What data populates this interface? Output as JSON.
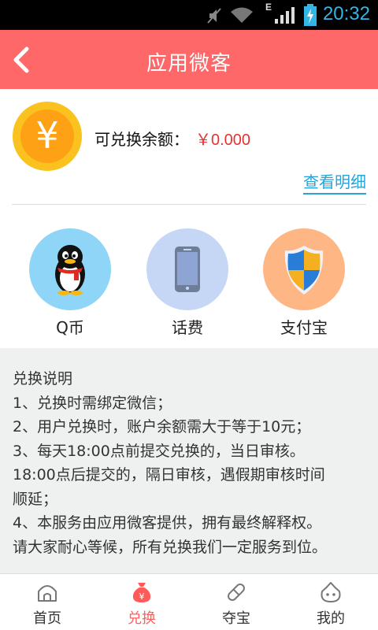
{
  "status_bar": {
    "time": "20:32",
    "network": "E"
  },
  "header": {
    "title": "应用微客"
  },
  "balance": {
    "label": "可兑换余额：",
    "value": "￥0.000",
    "coin_symbol": "¥",
    "detail_link": "查看明细"
  },
  "options": [
    {
      "label": "Q币",
      "icon": "penguin-icon",
      "bg": "#8fd5f7"
    },
    {
      "label": "话费",
      "icon": "phone-icon",
      "bg": "#c6d7f6"
    },
    {
      "label": "支付宝",
      "icon": "shield-icon",
      "bg": "#ffb685"
    }
  ],
  "info": {
    "lines": [
      "兑换说明",
      "1、兑换时需绑定微信；",
      "2、用户兑换时，账户余额需大于等于10元；",
      "3、每天18:00点前提交兑换的，当日审核。",
      "18:00点后提交的，隔日审核，遇假期审核时间",
      "顺延；",
      "4、本服务由应用微客提供，拥有最终解释权。",
      "请大家耐心等候，所有兑换我们一定服务到位。"
    ]
  },
  "tabbar": {
    "items": [
      {
        "label": "首页",
        "icon": "home-icon"
      },
      {
        "label": "兑换",
        "icon": "money-bag-icon"
      },
      {
        "label": "夺宝",
        "icon": "capsule-icon"
      },
      {
        "label": "我的",
        "icon": "face-icon"
      }
    ],
    "active_index": 1
  },
  "colors": {
    "header": "#fe6868",
    "accent_red": "#e73232",
    "link_blue": "#28a3d8",
    "info_bg": "#eff0f0"
  }
}
